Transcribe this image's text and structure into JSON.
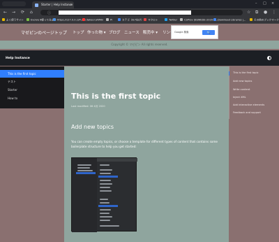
{
  "browser": {
    "tab_title": "Starter | Help Instance",
    "tab_close": "×",
    "window_controls": [
      "–",
      "□",
      "×"
    ],
    "nav": {
      "back": "←",
      "forward": "→",
      "reload": "⟳",
      "home": "⌂"
    },
    "bookmarks": [
      {
        "label": "よく使うサイト",
        "color": "#e8b800"
      },
      {
        "label": "Evolve Ⅲ使ってみよう",
        "color": "#7bc043"
      },
      {
        "label": "https://127.0.0.1/Purch...",
        "color": "#4a90e2"
      },
      {
        "label": "Yahoo! JAPAN",
        "color": "#ff3333"
      },
      {
        "label": "Pi",
        "color": "#bbbbbb"
      },
      {
        "label": "カテゴ（IE7向け）-",
        "color": "#4285f4"
      },
      {
        "label": "マクロト",
        "color": "#d44"
      },
      {
        "label": "Twitter",
        "color": "#1da1f2"
      },
      {
        "label": "CSProv (BSWEDE-2020-1...",
        "color": "#bbbbbb"
      },
      {
        "label": "Download Libraries |...",
        "color": "#4285f4"
      },
      {
        "label": "その他のブックマーク",
        "color": "#e8b800"
      }
    ]
  },
  "site": {
    "title": "マゼピンのページトップ",
    "menu": [
      "トップ",
      "作った物 ▾",
      "ブログ",
      "ニュース",
      "販売中 ▾",
      "リンク集"
    ],
    "search_logo": "Google 検索",
    "search_button": "🔍",
    "copyright": "Copyright © マゼピン All rights reserved."
  },
  "help": {
    "title": "Help Instance",
    "sidebar": [
      "This is the first topic",
      "テスト",
      "Starter",
      "How to"
    ],
    "content": {
      "title": "This is the first topic",
      "modified": "Last modified: 06 4月 2020",
      "heading": "Add new topics",
      "paragraph": "You can create empty topics, or choose a template for different types of content that contains some boilerplate structure to help you get started:"
    },
    "toc": [
      "This is the first topic",
      "Add new topics",
      "Write content",
      "Inject XML",
      "Add interactive elements",
      "Feedback and support"
    ]
  },
  "colors": {
    "accent": "#307fff",
    "page_bg": "#8a7070",
    "content_bg": "#8fa59e",
    "dark": "#1c1f24"
  }
}
